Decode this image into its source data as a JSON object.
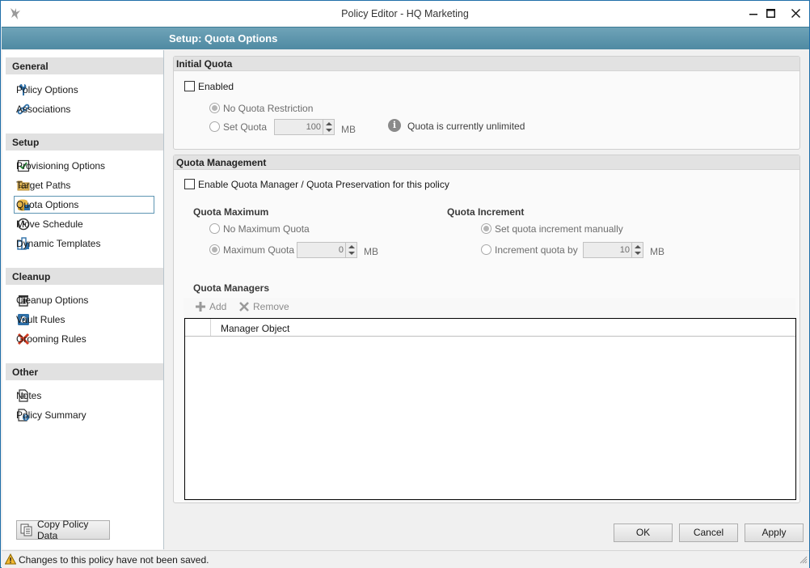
{
  "window": {
    "title": "Policy Editor - HQ Marketing",
    "header": "Setup: Quota Options"
  },
  "sidebar": {
    "sections": [
      {
        "label": "General",
        "items": [
          {
            "label": "Policy Options",
            "icon": "wrench-icon"
          },
          {
            "label": "Associations",
            "icon": "link-icon"
          }
        ]
      },
      {
        "label": "Setup",
        "items": [
          {
            "label": "Provisioning Options",
            "icon": "checkbox-icon"
          },
          {
            "label": "Target Paths",
            "icon": "folder-icon"
          },
          {
            "label": "Quota Options",
            "icon": "quota-db-icon",
            "active": true
          },
          {
            "label": "Move Schedule",
            "icon": "clock-icon"
          },
          {
            "label": "Dynamic Templates",
            "icon": "templates-icon"
          }
        ]
      },
      {
        "label": "Cleanup",
        "items": [
          {
            "label": "Cleanup Options",
            "icon": "trash-icon"
          },
          {
            "label": "Vault Rules",
            "icon": "vault-icon"
          },
          {
            "label": "Grooming Rules",
            "icon": "x-icon"
          }
        ]
      },
      {
        "label": "Other",
        "items": [
          {
            "label": "Notes",
            "icon": "document-icon"
          },
          {
            "label": "Policy Summary",
            "icon": "summary-icon"
          }
        ]
      }
    ],
    "copy_button": "Copy Policy Data"
  },
  "initial_quota": {
    "heading": "Initial Quota",
    "enabled_label": "Enabled",
    "no_restriction_label": "No Quota Restriction",
    "set_quota_label": "Set Quota",
    "set_quota_value": "100",
    "unit": "MB",
    "info_text": "Quota is currently unlimited"
  },
  "quota_management": {
    "heading": "Quota Management",
    "enable_label": "Enable Quota Manager / Quota Preservation for this policy",
    "maximum": {
      "heading": "Quota Maximum",
      "no_max_label": "No Maximum Quota",
      "max_label": "Maximum Quota",
      "max_value": "0",
      "unit": "MB"
    },
    "increment": {
      "heading": "Quota Increment",
      "manual_label": "Set quota increment manually",
      "increment_label": "Increment quota by",
      "increment_value": "10",
      "unit": "MB"
    },
    "managers": {
      "heading": "Quota Managers",
      "add_label": "Add",
      "remove_label": "Remove",
      "column_header": "Manager Object"
    }
  },
  "buttons": {
    "ok": "OK",
    "cancel": "Cancel",
    "apply": "Apply"
  },
  "status": {
    "text": "Changes to this policy have not been saved."
  }
}
